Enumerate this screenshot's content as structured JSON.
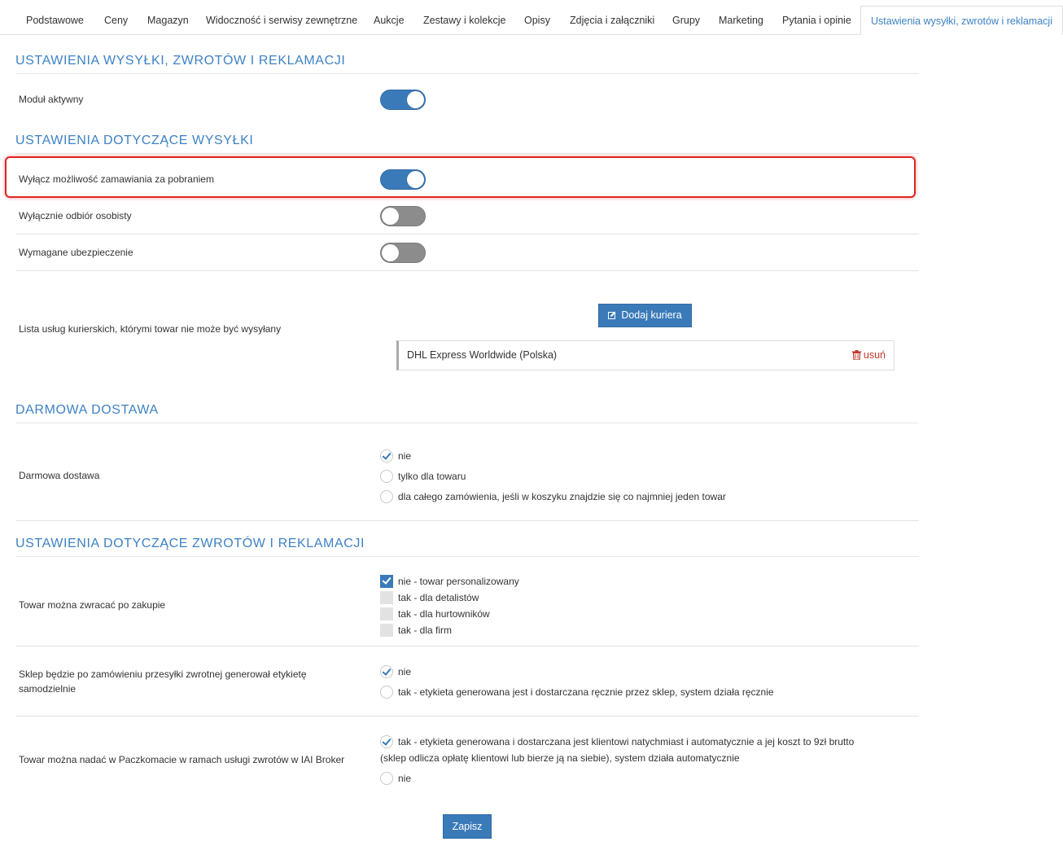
{
  "tabs": [
    "Podstawowe",
    "Ceny",
    "Magazyn",
    "Widoczność i serwisy zewnętrzne",
    "Aukcje",
    "Zestawy i kolekcje",
    "Opisy",
    "Zdjęcia i załączniki",
    "Grupy",
    "Marketing",
    "Pytania i opinie",
    "Ustawienia wysyłki, zwrotów i reklamacji"
  ],
  "active_tab": "Ustawienia wysyłki, zwrotów i reklamacji",
  "section_main": {
    "heading": "USTAWIENIA WYSYŁKI, ZWROTÓW I REKLAMACJI",
    "module_active_label": "Moduł aktywny",
    "module_active": true
  },
  "section_shipping": {
    "heading": "USTAWIENIA DOTYCZĄCE WYSYŁKI",
    "rows": [
      {
        "label": "Wyłącz możliwość zamawiania za pobraniem",
        "on": true
      },
      {
        "label": "Wyłącznie odbiór osobisty",
        "on": false
      },
      {
        "label": "Wymagane ubezpieczenie",
        "on": false
      }
    ],
    "courier_list_label": "Lista usług kurierskich, którymi towar nie może być wysyłany",
    "add_courier_button": "Dodaj kuriera",
    "couriers": [
      {
        "name": "DHL Express Worldwide (Polska)",
        "remove_label": "usuń"
      }
    ]
  },
  "section_free": {
    "heading": "DARMOWA DOSTAWA",
    "label": "Darmowa dostawa",
    "options": [
      {
        "text": "nie",
        "checked": true
      },
      {
        "text": "tylko dla towaru",
        "checked": false
      },
      {
        "text": "dla całego zamówienia, jeśli w koszyku znajdzie się co najmniej jeden towar",
        "checked": false
      }
    ]
  },
  "section_returns": {
    "heading": "USTAWIENIA DOTYCZĄCE ZWROTÓW I REKLAMACJI",
    "returnable": {
      "label": "Towar można zwracać po zakupie",
      "options": [
        {
          "text": "nie - towar personalizowany",
          "checked": true
        },
        {
          "text": "tak - dla detalistów",
          "checked": false
        },
        {
          "text": "tak - dla hurtowników",
          "checked": false
        },
        {
          "text": "tak - dla firm",
          "checked": false
        }
      ]
    },
    "label_generation": {
      "label_line1": "Sklep będzie po zamówieniu przesyłki zwrotnej generował etykietę",
      "label_line2": "samodzielnie",
      "options": [
        {
          "text": "nie",
          "checked": true
        },
        {
          "text": "tak - etykieta generowana jest i dostarczana ręcznie przez sklep, system działa ręcznie",
          "checked": false
        }
      ]
    },
    "paczkomat": {
      "label": "Towar można nadać w Paczkomacie w ramach usługi zwrotów w IAI Broker",
      "options": [
        {
          "text_line1": "tak - etykieta generowana i dostarczana jest klientowi natychmiast i automatycznie a jej koszt to 9zł brutto",
          "text_line2": "(sklep odlicza opłatę klientowi lub bierze ją na siebie), system działa automatycznie",
          "checked": true
        },
        {
          "text": "nie",
          "checked": false
        }
      ]
    }
  },
  "save_button": "Zapisz",
  "colors": {
    "accent": "#3a7ab8",
    "heading": "#3e82c4",
    "highlight": "#e02424",
    "remove": "#c0392b"
  }
}
